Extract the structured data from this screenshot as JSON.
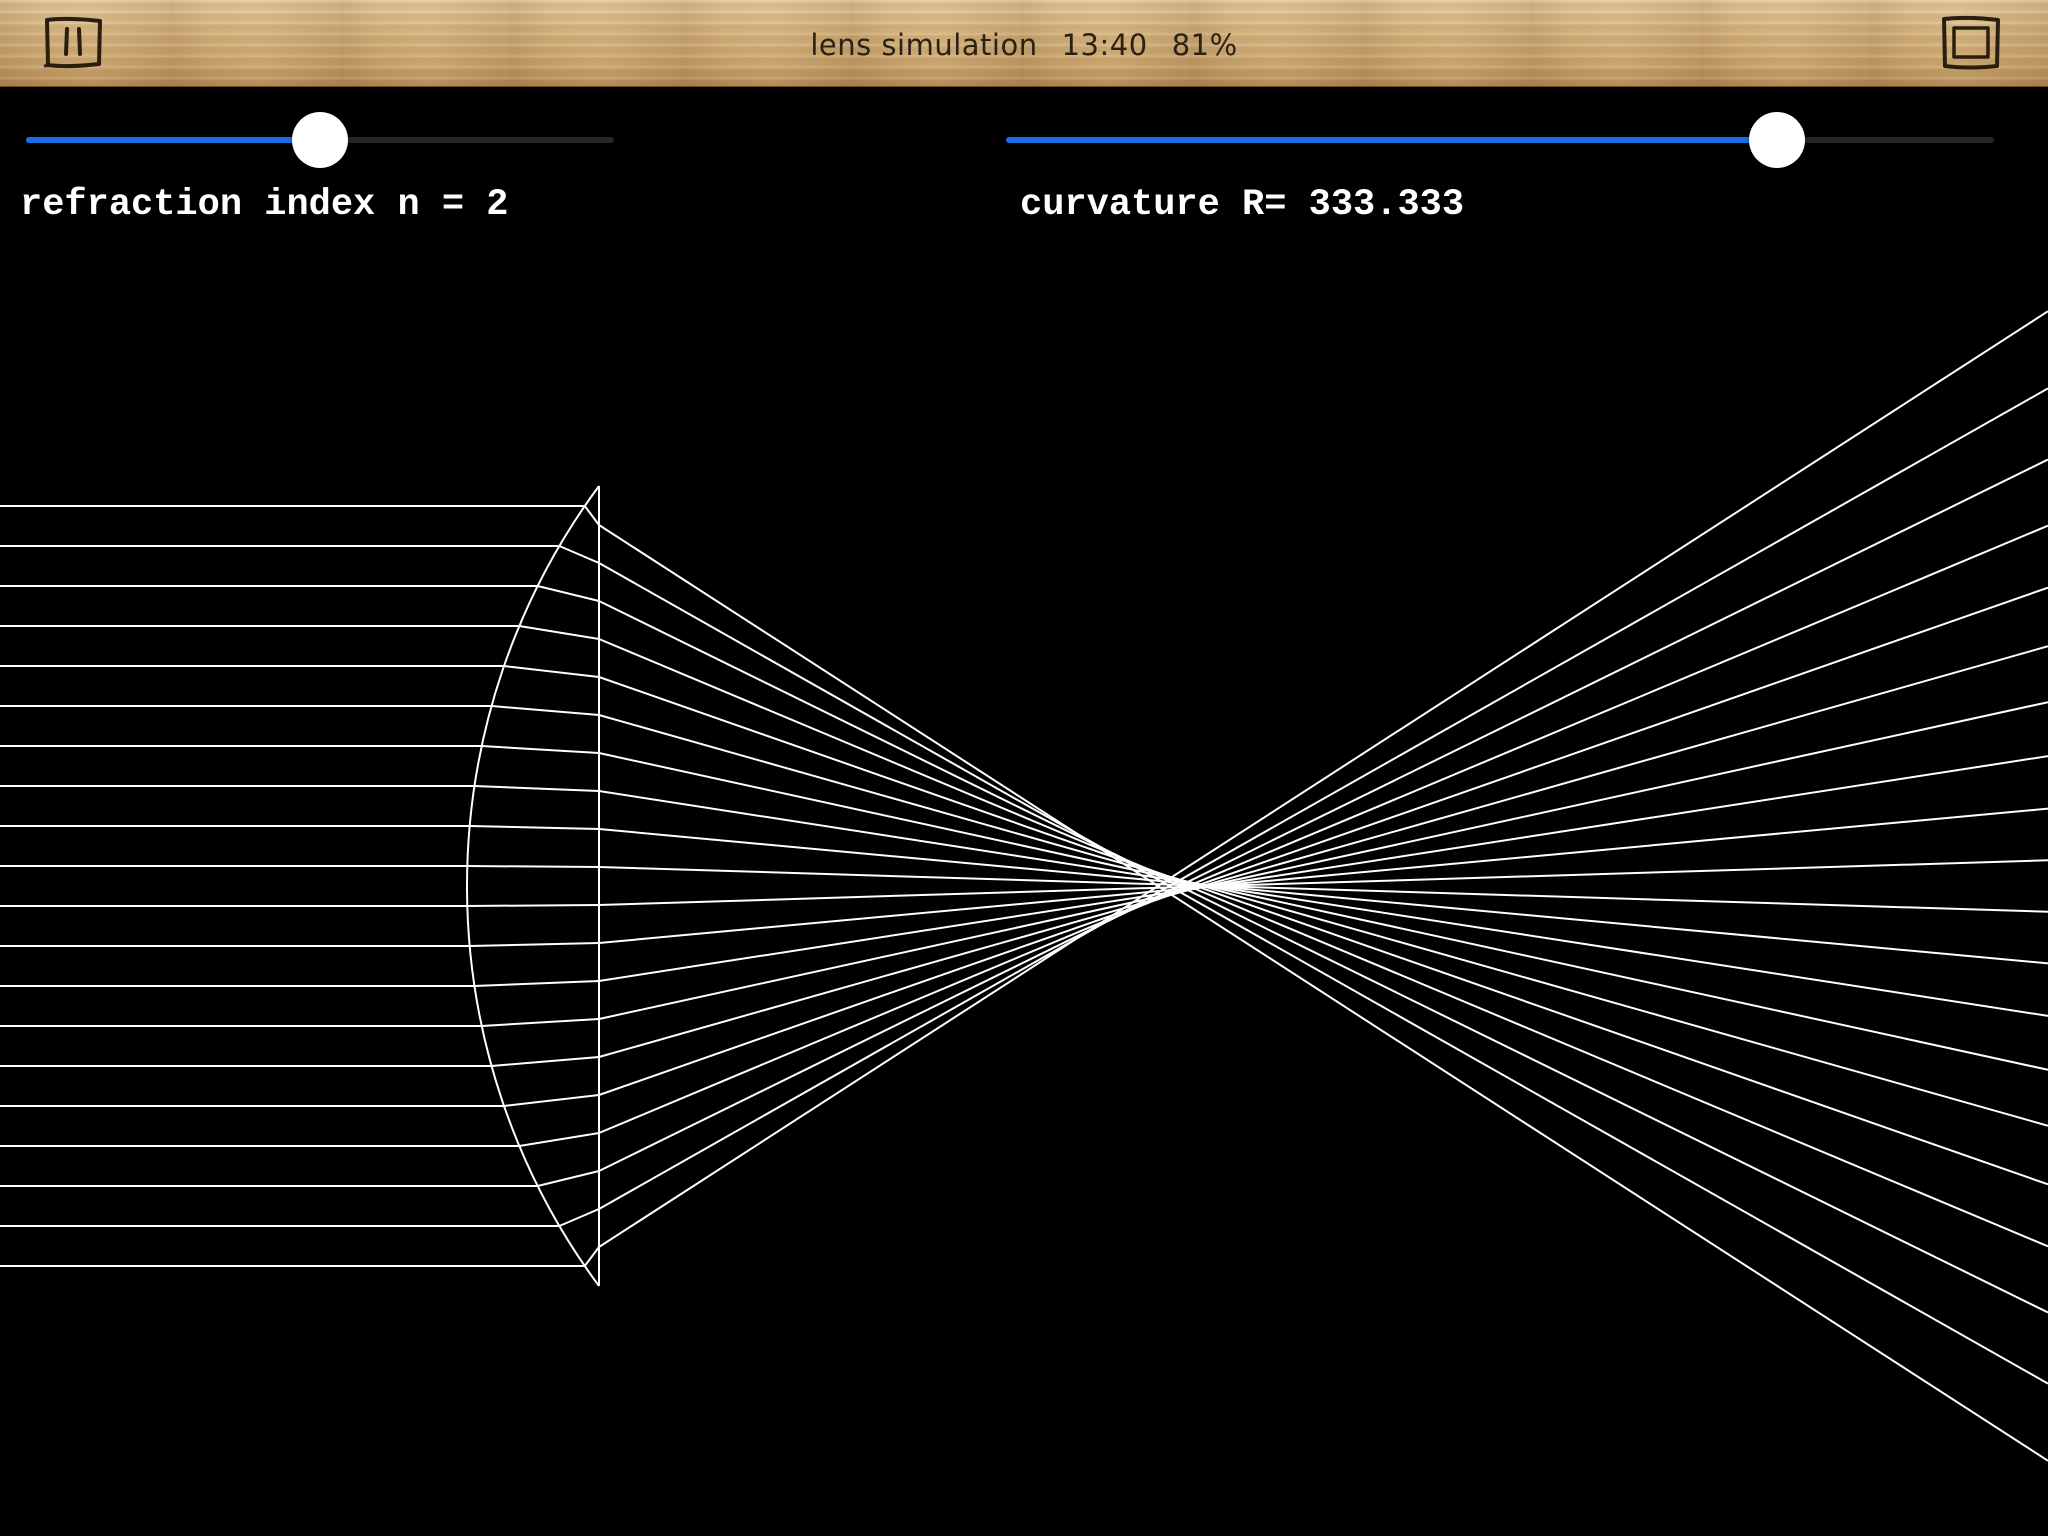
{
  "topbar": {
    "title": "lens simulation",
    "time": "13:40",
    "battery": "81%",
    "pause_icon": "pause-icon",
    "frame_icon": "frame-icon"
  },
  "controls": {
    "refraction": {
      "label": "refraction index n = 2",
      "value_fraction": 0.5
    },
    "curvature": {
      "label": "curvature R= 333.333",
      "value_fraction": 0.78
    }
  },
  "colors": {
    "background": "#000000",
    "ray": "#ffffff",
    "slider_fill": "#1a6fe8",
    "slider_track": "#262626",
    "wood": "#d3b07a",
    "wood_text": "#2b2114"
  },
  "simulation": {
    "refraction_index": 2,
    "curvature_radius": 333.333,
    "ray_count": 20
  }
}
